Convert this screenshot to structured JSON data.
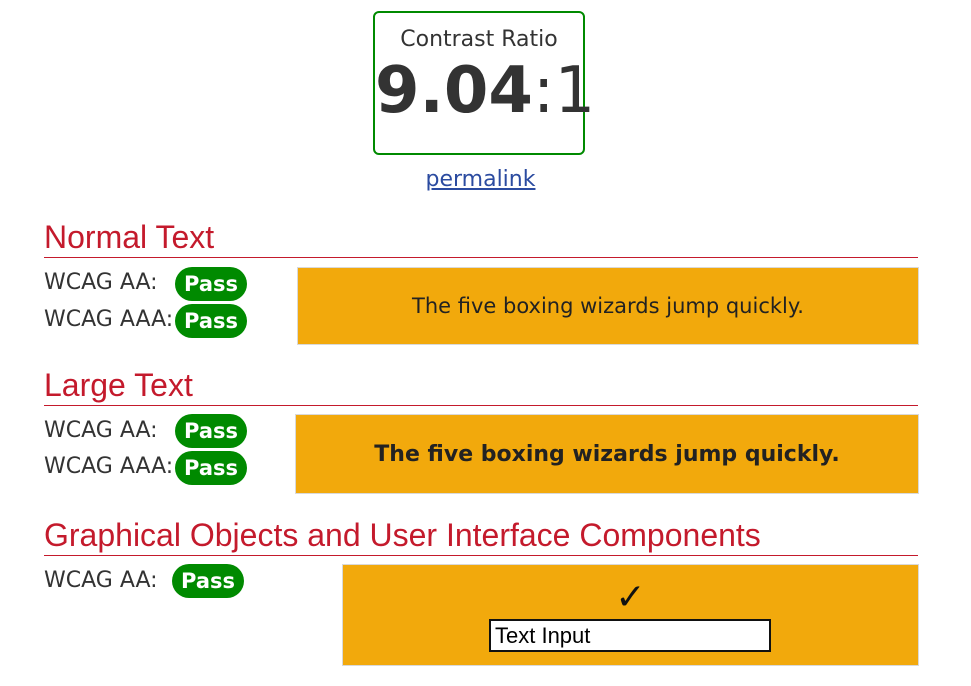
{
  "ratio": {
    "label": "Contrast Ratio",
    "value": "9.04",
    "separator": ":",
    "suffix": "1"
  },
  "permalink": "permalink",
  "sections": {
    "normal": {
      "title": "Normal Text",
      "aa_label": "WCAG AA:",
      "aa_result": "Pass",
      "aaa_label": "WCAG AAA:",
      "aaa_result": "Pass",
      "sample": "The five boxing wizards jump quickly."
    },
    "large": {
      "title": "Large Text",
      "aa_label": "WCAG AA:",
      "aa_result": "Pass",
      "aaa_label": "WCAG AAA:",
      "aaa_result": "Pass",
      "sample": "The five boxing wizards jump quickly."
    },
    "graphical": {
      "title": "Graphical Objects and User Interface Components",
      "aa_label": "WCAG AA:",
      "aa_result": "Pass",
      "check_symbol": "✓",
      "input_value": "Text Input"
    }
  },
  "colors": {
    "pass": "#008a00",
    "heading": "#c41a2c",
    "sample_background": "#f2a90c",
    "link": "#2b4ba0"
  },
  "icons": {
    "check": "checkmark-icon"
  }
}
